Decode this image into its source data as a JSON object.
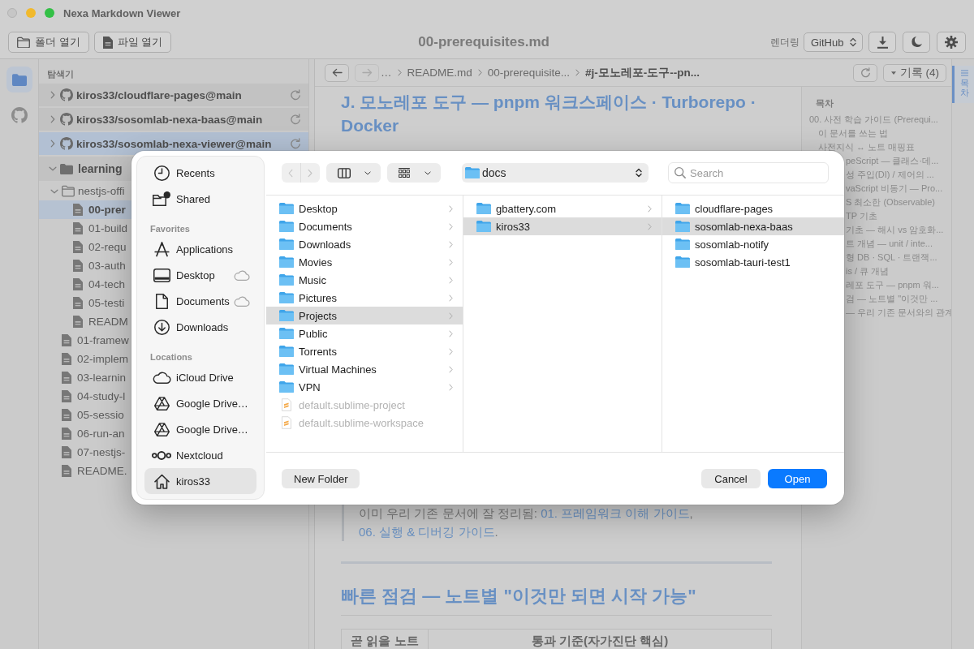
{
  "window": {
    "title": "Nexa Markdown Viewer"
  },
  "toolbar": {
    "buttons": [
      {
        "label": "폴더 열기"
      },
      {
        "label": "파일 열기"
      }
    ],
    "document_title": "00-prerequisites.md",
    "render_label": "렌더링",
    "render_select": "GitHub"
  },
  "activity_bar": {
    "items": [
      {
        "selected": true
      },
      {
        "selected": false
      }
    ]
  },
  "sidebar": {
    "title": "탐색기",
    "sections": [
      {
        "kind": "repo",
        "name": "kiros33/cloudflare-pages@main",
        "expanded": false,
        "selected": false
      },
      {
        "kind": "repo",
        "name": "kiros33/sosomlab-nexa-baas@main",
        "expanded": false,
        "selected": false
      },
      {
        "kind": "repo",
        "name": "kiros33/sosomlab-nexa-viewer@main",
        "expanded": false,
        "selected": true
      },
      {
        "kind": "folder",
        "name": "learning",
        "expanded": true,
        "selected": false,
        "children": [
          {
            "kind": "folder",
            "name": "nestjs-offi",
            "expanded": true,
            "selected": false,
            "children": [
              {
                "kind": "file",
                "name": "00-prer",
                "selected": true
              },
              {
                "kind": "file",
                "name": "01-build",
                "selected": false
              },
              {
                "kind": "file",
                "name": "02-requ",
                "selected": false
              },
              {
                "kind": "file",
                "name": "03-auth",
                "selected": false
              },
              {
                "kind": "file",
                "name": "04-tech",
                "selected": false
              },
              {
                "kind": "file",
                "name": "05-testi",
                "selected": false
              },
              {
                "kind": "file",
                "name": "READM",
                "selected": false
              }
            ]
          },
          {
            "kind": "file",
            "name": "01-framew",
            "selected": false
          },
          {
            "kind": "file",
            "name": "02-implem",
            "selected": false
          },
          {
            "kind": "file",
            "name": "03-learnin",
            "selected": false
          },
          {
            "kind": "file",
            "name": "04-study-l",
            "selected": false
          },
          {
            "kind": "file",
            "name": "05-sessio",
            "selected": false
          },
          {
            "kind": "file",
            "name": "06-run-an",
            "selected": false
          },
          {
            "kind": "file",
            "name": "07-nestjs-",
            "selected": false
          },
          {
            "kind": "file",
            "name": "README.",
            "selected": false
          }
        ]
      }
    ]
  },
  "breadcrumb": {
    "back": {
      "disabled": false
    },
    "forward": {
      "disabled": true
    },
    "crumbs": [
      {
        "text": "…",
        "current": false
      },
      {
        "text": "README.md",
        "current": false
      },
      {
        "text": "00-prerequisite...",
        "current": false
      },
      {
        "text": "#j-모노레포-도구--pn...",
        "current": true
      }
    ],
    "history_button": "기록 (4)"
  },
  "content": {
    "heading": "J. 모노레포 도구 — pnpm 워크스페이스 · Turborepo · Docker",
    "note": [
      {
        "kind": "text",
        "text": "이미 우리 기존 문서에 잘 정리됨: "
      },
      {
        "kind": "link",
        "text": "01. 프레임워크 이해 가이드"
      },
      {
        "kind": "text",
        "text": ", "
      },
      {
        "kind": "link",
        "text": "06. 실행 & 디버깅 가이드"
      },
      {
        "kind": "text",
        "text": "."
      }
    ],
    "section_heading": "빠른 점검 — 노트별 \"이것만 되면 시작 가능\"",
    "table": {
      "columns": [
        "곧 읽을 노트",
        "통과 기준(자가진단 핵심)"
      ]
    }
  },
  "toc": {
    "title": "목차",
    "items": [
      {
        "text": "00. 사전 학습 가이드 (Prerequi...",
        "children": [
          {
            "text": "이 문서를 쓰는 법"
          },
          {
            "text": "사전지식 ↔ 노트 매핑표"
          }
        ],
        "clipped_children": [
          {
            "text": "peScript — 클래스·데..."
          },
          {
            "text": "성 주입(DI) / 제어의 ..."
          },
          {
            "text": "vaScript 비동기 — Pro..."
          },
          {
            "text": "S 최소한 (Observable)"
          },
          {
            "text": "TP 기초"
          },
          {
            "text": "기초 — 해시 vs 암호화..."
          },
          {
            "text": "트 개념 — unit / inte..."
          },
          {
            "text": "형 DB · SQL · 트랜잭..."
          },
          {
            "text": "is / 큐 개념"
          },
          {
            "text": "레포 도구 — pnpm 워..."
          },
          {
            "text": "검 — 노트별 \"이것만 ..."
          },
          {
            "text": "— 우리 기존 문서와의 관계"
          }
        ]
      }
    ]
  },
  "side_tab": {
    "label": "목차",
    "selected": true
  },
  "file_dialog": {
    "back": {
      "disabled": true
    },
    "forward": {
      "disabled": true
    },
    "location": "docs",
    "search": {
      "placeholder": "Search"
    },
    "sidebar": [
      {
        "items": [
          {
            "label": "Recents",
            "selected": false,
            "cloud": false
          },
          {
            "label": "Shared",
            "selected": false,
            "cloud": false
          }
        ]
      },
      {
        "title": "Favorites",
        "items": [
          {
            "label": "Applications",
            "selected": false,
            "cloud": false
          },
          {
            "label": "Desktop",
            "selected": false,
            "cloud": true
          },
          {
            "label": "Documents",
            "selected": false,
            "cloud": true
          },
          {
            "label": "Downloads",
            "selected": false,
            "cloud": false
          }
        ]
      },
      {
        "title": "Locations",
        "items": [
          {
            "label": "iCloud Drive",
            "selected": false,
            "cloud": false
          },
          {
            "label": "Google Drive…",
            "selected": false,
            "cloud": false
          },
          {
            "label": "Google Drive…",
            "selected": false,
            "cloud": false
          },
          {
            "label": "Nextcloud",
            "selected": false,
            "cloud": false
          },
          {
            "label": "kiros33",
            "selected": true,
            "cloud": false
          }
        ]
      }
    ],
    "columns": [
      {
        "items": [
          {
            "kind": "folder",
            "name": "Desktop",
            "selected": false,
            "disabled": false,
            "expandable": true
          },
          {
            "kind": "folder",
            "name": "Documents",
            "selected": false,
            "disabled": false,
            "expandable": true
          },
          {
            "kind": "folder",
            "name": "Downloads",
            "selected": false,
            "disabled": false,
            "expandable": true
          },
          {
            "kind": "folder",
            "name": "Movies",
            "selected": false,
            "disabled": false,
            "expandable": true
          },
          {
            "kind": "folder",
            "name": "Music",
            "selected": false,
            "disabled": false,
            "expandable": true
          },
          {
            "kind": "folder",
            "name": "Pictures",
            "selected": false,
            "disabled": false,
            "expandable": true
          },
          {
            "kind": "folder",
            "name": "Projects",
            "selected": true,
            "disabled": false,
            "expandable": true
          },
          {
            "kind": "folder",
            "name": "Public",
            "selected": false,
            "disabled": false,
            "expandable": true
          },
          {
            "kind": "folder",
            "name": "Torrents",
            "selected": false,
            "disabled": false,
            "expandable": true
          },
          {
            "kind": "folder",
            "name": "Virtual Machines",
            "selected": false,
            "disabled": false,
            "expandable": true
          },
          {
            "kind": "folder",
            "name": "VPN",
            "selected": false,
            "disabled": false,
            "expandable": true
          },
          {
            "kind": "file",
            "name": "default.sublime-project",
            "selected": false,
            "disabled": true,
            "expandable": false
          },
          {
            "kind": "file",
            "name": "default.sublime-workspace",
            "selected": false,
            "disabled": true,
            "expandable": false
          }
        ]
      },
      {
        "items": [
          {
            "kind": "folder",
            "name": "gbattery.com",
            "selected": false,
            "disabled": false,
            "expandable": true
          },
          {
            "kind": "folder",
            "name": "kiros33",
            "selected": true,
            "disabled": false,
            "expandable": true
          }
        ]
      },
      {
        "items": [
          {
            "kind": "folder",
            "name": "cloudflare-pages",
            "selected": false,
            "disabled": false,
            "expandable": false
          },
          {
            "kind": "folder",
            "name": "sosomlab-nexa-baas",
            "selected": true,
            "disabled": false,
            "expandable": false
          },
          {
            "kind": "folder",
            "name": "sosomlab-notify",
            "selected": false,
            "disabled": false,
            "expandable": false
          },
          {
            "kind": "folder",
            "name": "sosomlab-tauri-test1",
            "selected": false,
            "disabled": false,
            "expandable": false
          }
        ]
      }
    ],
    "buttons": [
      {
        "label": "New Folder",
        "kind": "secondary"
      },
      {
        "label": "Cancel",
        "kind": "secondary"
      },
      {
        "label": "Open",
        "kind": "primary"
      }
    ]
  }
}
